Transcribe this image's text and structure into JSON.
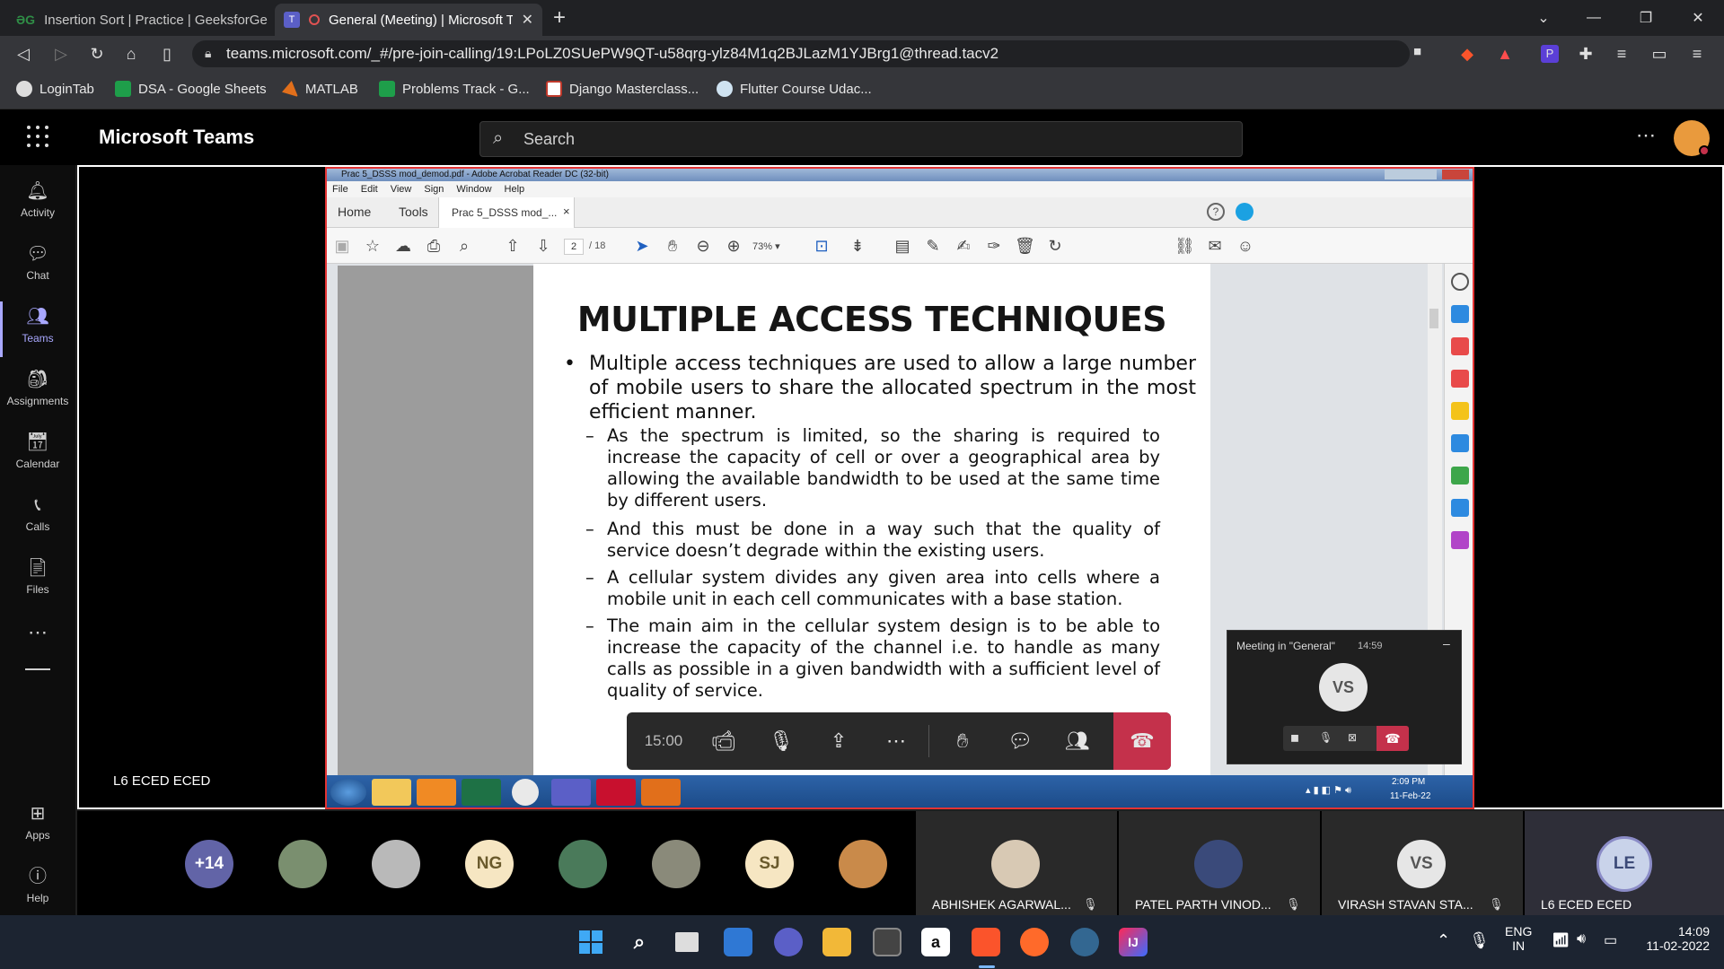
{
  "browser": {
    "tabs": [
      {
        "label": "Insertion Sort | Practice | GeeksforGeeks",
        "favicon": "gfg-icon"
      },
      {
        "label": "General (Meeting) | Microsoft Teams",
        "favicon": "teams-icon"
      }
    ],
    "url": "teams.microsoft.com/_#/pre-join-calling/19:LPoLZ0SUePW9QT-u58qrg-ylz84M1q2BJLazM1YJBrg1@thread.tacv2",
    "bookmarks": [
      "LoginTab",
      "DSA - Google Sheets",
      "MATLAB",
      "Problems Track - G...",
      "Django Masterclass...",
      "Flutter Course Udac..."
    ]
  },
  "teams": {
    "app_title": "Microsoft Teams",
    "search_placeholder": "Search",
    "rail": [
      {
        "label": "Activity"
      },
      {
        "label": "Chat"
      },
      {
        "label": "Teams"
      },
      {
        "label": "Assignments"
      },
      {
        "label": "Calendar"
      },
      {
        "label": "Calls"
      },
      {
        "label": "Files"
      },
      {
        "label": "Apps"
      },
      {
        "label": "Help"
      }
    ],
    "presenter_label": "L6 ECED ECED"
  },
  "acrobat": {
    "title": "Prac 5_DSSS mod_demod.pdf - Adobe Acrobat Reader DC (32-bit)",
    "menu": [
      "File",
      "Edit",
      "View",
      "Sign",
      "Window",
      "Help"
    ],
    "tabs": [
      "Home",
      "Tools",
      "Prac 5_DSSS mod_..."
    ],
    "page_current": "2",
    "page_total": "/ 18",
    "zoom": "73%",
    "taskbar_time": "2:09 PM",
    "taskbar_date": "11-Feb-22"
  },
  "slide": {
    "title": "MULTIPLE ACCESS TECHNIQUES",
    "bullet": "Multiple access techniques are used to allow a large number of mobile users to share the allocated spectrum in the most efficient manner.",
    "sub": [
      "As the spectrum is limited, so the sharing is required to increase the capacity of cell or over a geographical area by allowing the available bandwidth to be used at the same time by different users.",
      "And this must be done in a way such that the quality of service doesn’t degrade within the existing users.",
      "A cellular system divides any given area into cells where a mobile unit in each cell communicates with a base station.",
      "The main aim in the cellular system design is to be able to increase the capacity of the channel i.e. to handle as many calls as possible in a given bandwidth with a sufficient level of quality of service."
    ]
  },
  "mini_meeting": {
    "title": "Meeting in \"General\"",
    "duration": "14:59",
    "initials": "VS"
  },
  "controls": {
    "timer": "15:00"
  },
  "participants": {
    "overflow": "+14",
    "initials_avatars": [
      "NG",
      "SJ"
    ],
    "tiles": [
      {
        "name": "ABHISHEK AGARWAL..."
      },
      {
        "name": "PATEL PARTH VINOD..."
      },
      {
        "name": "VIRASH STAVAN STA...",
        "initials": "VS"
      },
      {
        "name": "L6 ECED ECED",
        "initials": "LE"
      }
    ]
  },
  "system_tray": {
    "lang": "ENG",
    "region": "IN",
    "time": "14:09",
    "date": "11-02-2022"
  },
  "colors": {
    "teams_accent": "#6264a7",
    "hangup_red": "#c4314b",
    "share_border": "#e43333"
  }
}
